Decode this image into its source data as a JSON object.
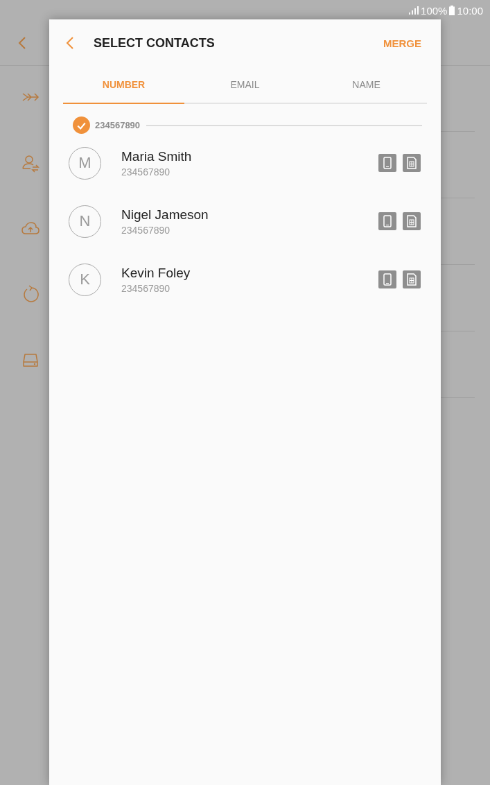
{
  "status_bar": {
    "battery": "100%",
    "time": "10:00"
  },
  "dialog": {
    "title": "SELECT CONTACTS",
    "action": "MERGE"
  },
  "tabs": [
    {
      "label": "NUMBER",
      "selected": true
    },
    {
      "label": "EMAIL",
      "selected": false
    },
    {
      "label": "NAME",
      "selected": false
    }
  ],
  "group": {
    "number": "234567890",
    "checked": true
  },
  "contacts": [
    {
      "initial": "M",
      "name": "Maria Smith",
      "number": "234567890"
    },
    {
      "initial": "N",
      "name": "Nigel Jameson",
      "number": "234567890"
    },
    {
      "initial": "K",
      "name": "Kevin Foley",
      "number": "234567890"
    }
  ]
}
